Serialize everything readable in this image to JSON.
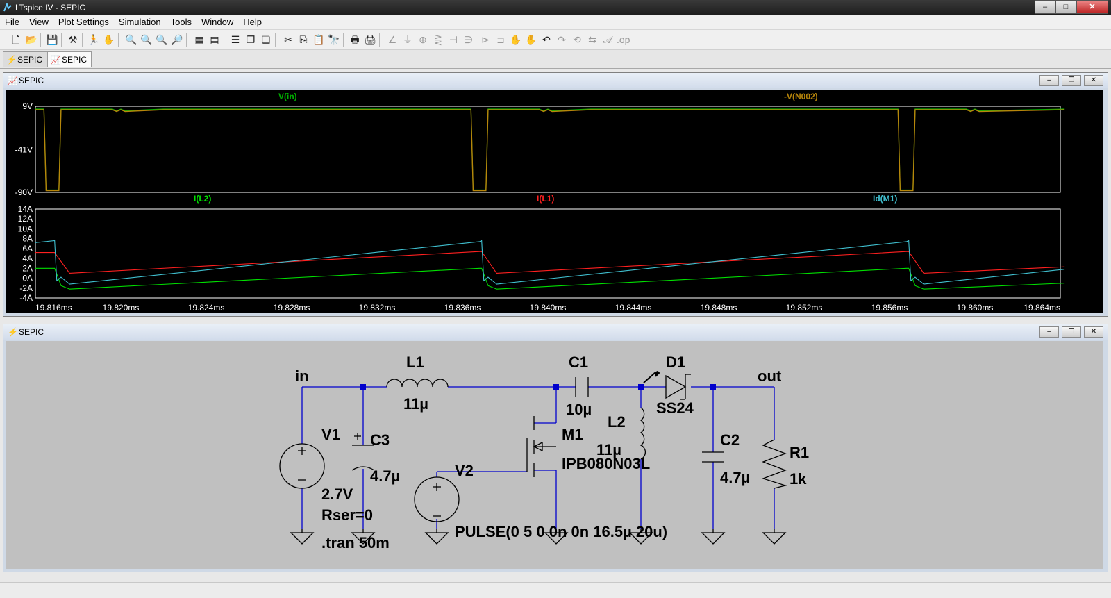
{
  "window": {
    "title": "LTspice IV - SEPIC",
    "min": "–",
    "max": "□",
    "close": "✕"
  },
  "menu": [
    "File",
    "View",
    "Plot Settings",
    "Simulation",
    "Tools",
    "Window",
    "Help"
  ],
  "tabs": [
    {
      "label": "SEPIC",
      "icon": "schematic-icon"
    },
    {
      "label": "SEPIC",
      "icon": "waveform-icon"
    }
  ],
  "plot_window": {
    "title": "SEPIC",
    "icon": "waveform-icon"
  },
  "schematic_window": {
    "title": "SEPIC",
    "icon": "schematic-icon"
  },
  "colors": {
    "vin": "#00b000",
    "vn002": "#b8860b",
    "il2": "#00e000",
    "il1": "#ff2020",
    "idm1": "#40c0d0",
    "axis": "#ffffff",
    "wire": "#0000cc",
    "component": "#000000"
  },
  "chart_data": [
    {
      "type": "line",
      "title": "",
      "xlabel": "",
      "ylabel": "",
      "ylim": [
        -90,
        9
      ],
      "y_ticks": [
        "9V",
        "-41V",
        "-90V"
      ],
      "series": [
        {
          "name": "V(in)",
          "values_note": ""
        },
        {
          "name": "-V(N002)",
          "x": [
            19.816,
            19.8164,
            19.8165,
            19.8171,
            19.8172,
            19.8185,
            19.8196,
            19.8198,
            19.82,
            19.8202,
            19.822,
            19.8364,
            19.8365,
            19.8371,
            19.8372,
            19.8384,
            19.8396,
            19.8398,
            19.84,
            19.8402,
            19.842,
            19.8564,
            19.8565,
            19.8571,
            19.8572,
            19.8584,
            19.8596,
            19.8598,
            19.86,
            19.8602,
            19.8642
          ],
          "values": [
            5,
            5,
            -88,
            -88,
            5,
            5,
            5,
            3,
            5,
            3,
            5,
            5,
            -88,
            -88,
            5,
            5,
            5,
            3,
            5,
            3,
            5,
            5,
            -88,
            -88,
            5,
            5,
            5,
            3,
            5,
            3,
            5
          ]
        }
      ]
    },
    {
      "type": "line",
      "title": "",
      "xlabel": "",
      "ylabel": "",
      "ylim": [
        -4,
        14
      ],
      "xlim": [
        19.816,
        19.864
      ],
      "y_ticks": [
        "14A",
        "12A",
        "10A",
        "8A",
        "6A",
        "4A",
        "2A",
        "0A",
        "-2A",
        "-4A"
      ],
      "x_ticks": [
        "19.816ms",
        "19.820ms",
        "19.824ms",
        "19.828ms",
        "19.832ms",
        "19.836ms",
        "19.840ms",
        "19.844ms",
        "19.848ms",
        "19.852ms",
        "19.856ms",
        "19.860ms",
        "19.864ms"
      ],
      "series": [
        {
          "name": "I(L2)",
          "x": [
            19.816,
            19.8169,
            19.8172,
            19.8176,
            19.8368,
            19.8369,
            19.8372,
            19.8376,
            19.8568,
            19.8569,
            19.8572,
            19.8576,
            19.8642
          ],
          "values": [
            2.0,
            2.0,
            -1.5,
            -2.2,
            2.0,
            2.0,
            -1.5,
            -2.2,
            2.0,
            2.0,
            -1.5,
            -2.2,
            -1.0
          ]
        },
        {
          "name": "I(L1)",
          "x": [
            19.816,
            19.8169,
            19.8176,
            19.8368,
            19.8369,
            19.8376,
            19.8568,
            19.8569,
            19.8576,
            19.8642
          ],
          "values": [
            5.2,
            5.2,
            1.0,
            5.4,
            5.4,
            1.0,
            5.4,
            5.4,
            1.0,
            2.3
          ]
        },
        {
          "name": "Id(M1)",
          "x": [
            19.816,
            19.8169,
            19.817,
            19.8172,
            19.8176,
            19.8368,
            19.8369,
            19.837,
            19.8372,
            19.8376,
            19.8568,
            19.8569,
            19.857,
            19.8572,
            19.8576,
            19.8642
          ],
          "values": [
            7.2,
            7.6,
            -0.5,
            0.2,
            -1.2,
            7.4,
            7.6,
            -0.5,
            0.2,
            -1.2,
            7.4,
            7.6,
            -0.5,
            0.2,
            -1.2,
            1.8
          ]
        }
      ]
    }
  ],
  "schematic": {
    "net_in": "in",
    "net_out": "out",
    "V1": {
      "name": "V1",
      "value": "2.7V",
      "rser": "Rser=0"
    },
    "V2": {
      "name": "V2",
      "value": "PULSE(0 5 0 0n 0n 16.5µ 20u)"
    },
    "L1": {
      "name": "L1",
      "value": "11µ"
    },
    "L2": {
      "name": "L2",
      "value": "11µ"
    },
    "C1": {
      "name": "C1",
      "value": "10µ"
    },
    "C2": {
      "name": "C2",
      "value": "4.7µ"
    },
    "C3": {
      "name": "C3",
      "value": "4.7µ"
    },
    "D1": {
      "name": "D1",
      "value": "SS24"
    },
    "M1": {
      "name": "M1",
      "value": "IPB080N03L"
    },
    "R1": {
      "name": "R1",
      "value": "1k"
    },
    "directive": ".tran 50m"
  }
}
